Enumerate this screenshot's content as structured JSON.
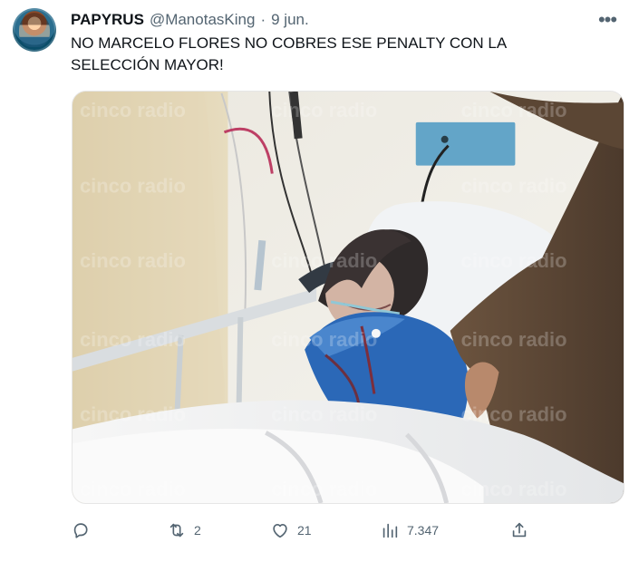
{
  "tweet": {
    "author": {
      "name": "PAPYRUS",
      "handle": "@ManotasKing",
      "separator": "·",
      "date": "9 jun."
    },
    "text": "NO MARCELO FLORES NO COBRES ESE PENALTY CON LA SELECCIÓN MAYOR!",
    "more_icon": "more-horizontal-icon",
    "media": {
      "watermark": "cinco radio",
      "description_icon": "photo"
    },
    "actions": {
      "reply_count": "",
      "retweet_count": "2",
      "like_count": "21",
      "views_count": "7.347"
    }
  }
}
